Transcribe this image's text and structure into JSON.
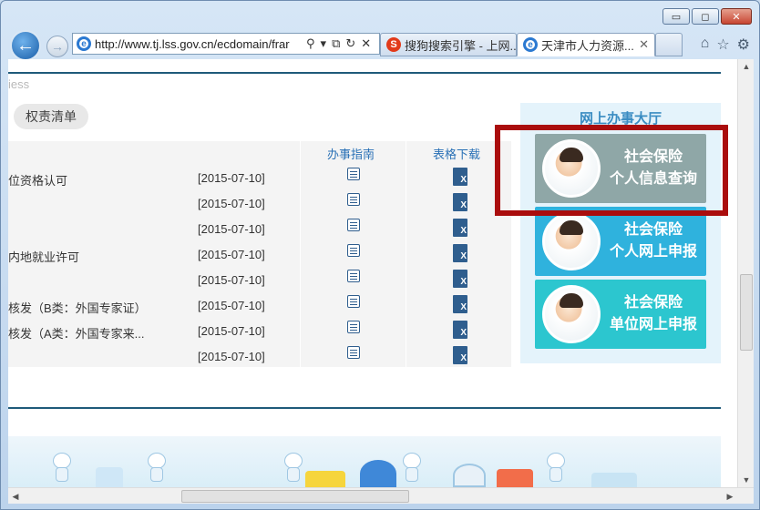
{
  "browser": {
    "url": "http://www.tj.lss.gov.cn/ecdomain/frar",
    "tabs": [
      {
        "label": "搜狗搜索引擎 - 上网..."
      },
      {
        "label": "天津市人力资源..."
      }
    ],
    "tab_close_glyph": "✕",
    "window_controls": {
      "minimize": "▭",
      "maximize": "◻",
      "close": "✕"
    }
  },
  "page": {
    "faded_text": "iess",
    "pill_label": "权责清单",
    "table": {
      "headers": {
        "guide": "办事指南",
        "download": "表格下载"
      },
      "rows": [
        {
          "name": "位资格认可",
          "date": "[2015-07-10]"
        },
        {
          "name": "",
          "date": "[2015-07-10]"
        },
        {
          "name": "",
          "date": "[2015-07-10]"
        },
        {
          "name": "内地就业许可",
          "date": "[2015-07-10]"
        },
        {
          "name": "",
          "date": "[2015-07-10]"
        },
        {
          "name": "核发（B类：外国专家证）",
          "date": "[2015-07-10]"
        },
        {
          "name": "核发（A类：外国专家来...",
          "date": "[2015-07-10]"
        },
        {
          "name": "",
          "date": "[2015-07-10]"
        }
      ],
      "xls_glyph": "X"
    },
    "side_panel": {
      "title": "网上办事大厅",
      "services": [
        {
          "line1": "社会保险",
          "line2": "个人信息查询"
        },
        {
          "line1": "社会保险",
          "line2": "个人网上申报"
        },
        {
          "line1": "社会保险",
          "line2": "单位网上申报"
        }
      ]
    }
  },
  "colors": {
    "highlight_box": "#aa0d0d",
    "accent_blue": "#2a71b6",
    "service_gray": "#8fa7a7",
    "service_blue": "#2fb2dd",
    "service_teal": "#2cc6cf"
  }
}
